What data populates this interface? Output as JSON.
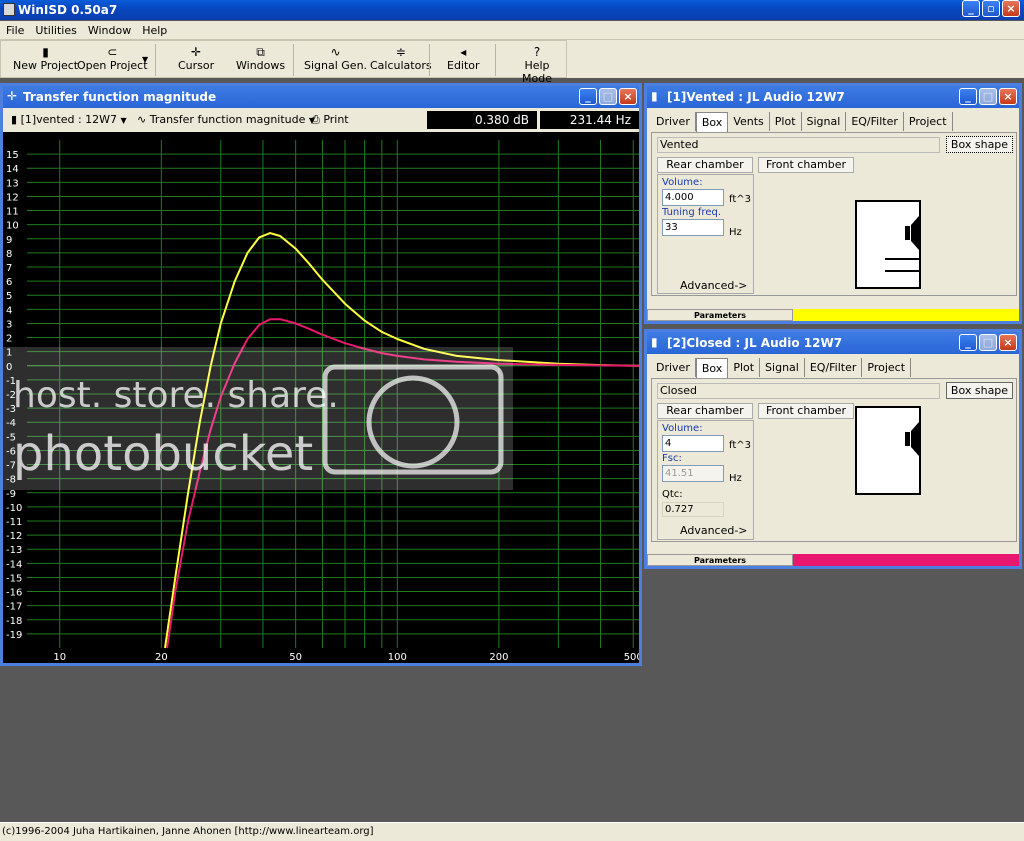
{
  "app": {
    "title": "WinISD 0.50a7"
  },
  "menu": {
    "items": [
      "File",
      "Utilities",
      "Window",
      "Help"
    ]
  },
  "toolbar": {
    "buttons": [
      {
        "label": "New Project",
        "icon": "new-project-icon"
      },
      {
        "label": "Open Project",
        "icon": "open-project-icon"
      },
      {
        "label": "Cursor",
        "icon": "cursor-icon"
      },
      {
        "label": "Windows",
        "icon": "windows-icon"
      },
      {
        "label": "Signal Gen.",
        "icon": "signal-gen-icon"
      },
      {
        "label": "Calculators",
        "icon": "calculators-icon"
      },
      {
        "label": "Editor",
        "icon": "editor-icon"
      },
      {
        "label": "Help Mode",
        "icon": "help-icon"
      }
    ]
  },
  "graph": {
    "title": "Transfer function magnitude",
    "project_select": "[1]vented : 12W7",
    "plot_select": "Transfer function magnitude",
    "print_label": "Print",
    "readout_db": "0.380 dB",
    "readout_hz": "231.44 Hz"
  },
  "watermark": {
    "text": "host. store. share.",
    "brand": "photobucket"
  },
  "vented": {
    "title": "[1]Vented : JL Audio 12W7",
    "tabs": [
      "Driver",
      "Box",
      "Vents",
      "Plot",
      "Signal",
      "EQ/Filter",
      "Project"
    ],
    "active_tab": "Box",
    "box_type": "Vented",
    "box_shape_label": "Box shape",
    "rear_chamber_label": "Rear chamber",
    "front_chamber_label": "Front chamber",
    "volume_label": "Volume:",
    "volume_value": "4.000",
    "volume_unit": "ft^3",
    "tuning_label": "Tuning freq.",
    "tuning_value": "33",
    "tuning_unit": "Hz",
    "advanced_label": "Advanced->",
    "parameters_label": "Parameters",
    "color": "#ffff00"
  },
  "closed": {
    "title": "[2]Closed : JL Audio 12W7",
    "tabs": [
      "Driver",
      "Box",
      "Plot",
      "Signal",
      "EQ/Filter",
      "Project"
    ],
    "active_tab": "Box",
    "box_type": "Closed",
    "box_shape_label": "Box shape",
    "rear_chamber_label": "Rear chamber",
    "front_chamber_label": "Front chamber",
    "volume_label": "Volume:",
    "volume_value": "4",
    "volume_unit": "ft^3",
    "fsc_label": "Fsc:",
    "fsc_value": "41.51",
    "fsc_unit": "Hz",
    "qtc_label": "Qtc:",
    "qtc_value": "0.727",
    "advanced_label": "Advanced->",
    "parameters_label": "Parameters",
    "color": "#e8186e"
  },
  "status": {
    "text": "(c)1996-2004 Juha Hartikainen, Janne Ahonen [http://www.linearteam.org]"
  },
  "chart_data": {
    "type": "line",
    "xscale": "log",
    "xlim": [
      8,
      520
    ],
    "ylim": [
      -20,
      16
    ],
    "x_ticks": [
      "10",
      "20",
      "50",
      "100",
      "200",
      "500"
    ],
    "y_ticks": [
      "15",
      "14",
      "13",
      "12",
      "11",
      "10",
      "9",
      "8",
      "7",
      "6",
      "5",
      "4",
      "3",
      "2",
      "1",
      "0",
      "-1",
      "-2",
      "-3",
      "-4",
      "-5",
      "-6",
      "-7",
      "-8",
      "-9",
      "-10",
      "-11",
      "-12",
      "-13",
      "-14",
      "-15",
      "-16",
      "-17",
      "-18",
      "-19"
    ],
    "grid": true,
    "series": [
      {
        "color": "#ffff40",
        "points": [
          [
            20.5,
            -20
          ],
          [
            22,
            -15
          ],
          [
            24,
            -9
          ],
          [
            26,
            -4
          ],
          [
            28,
            0
          ],
          [
            30,
            3
          ],
          [
            33,
            6
          ],
          [
            36,
            8
          ],
          [
            39,
            9.1
          ],
          [
            42,
            9.4
          ],
          [
            45,
            9.2
          ],
          [
            50,
            8.3
          ],
          [
            55,
            7.2
          ],
          [
            60,
            6.1
          ],
          [
            70,
            4.4
          ],
          [
            80,
            3.2
          ],
          [
            90,
            2.4
          ],
          [
            100,
            1.9
          ],
          [
            120,
            1.2
          ],
          [
            150,
            0.7
          ],
          [
            200,
            0.4
          ],
          [
            300,
            0.15
          ],
          [
            400,
            0.05
          ],
          [
            520,
            0
          ]
        ]
      },
      {
        "color": "#e8186e",
        "points": [
          [
            20.8,
            -20
          ],
          [
            22,
            -16
          ],
          [
            24,
            -11
          ],
          [
            26,
            -7.5
          ],
          [
            28,
            -4.5
          ],
          [
            30,
            -2.2
          ],
          [
            33,
            0.2
          ],
          [
            36,
            1.9
          ],
          [
            39,
            2.9
          ],
          [
            42,
            3.3
          ],
          [
            45,
            3.3
          ],
          [
            50,
            3.0
          ],
          [
            55,
            2.6
          ],
          [
            60,
            2.2
          ],
          [
            70,
            1.6
          ],
          [
            80,
            1.2
          ],
          [
            90,
            0.9
          ],
          [
            100,
            0.7
          ],
          [
            120,
            0.45
          ],
          [
            150,
            0.28
          ],
          [
            200,
            0.15
          ],
          [
            300,
            0.06
          ],
          [
            520,
            0
          ]
        ]
      }
    ]
  }
}
